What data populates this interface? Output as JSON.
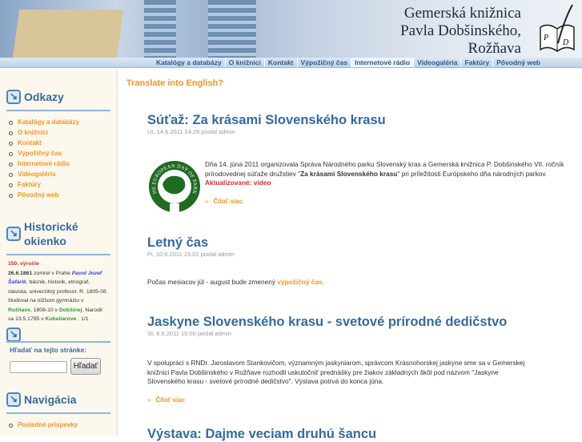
{
  "header": {
    "title_lines": [
      "Gemerská knižnica",
      "Pavla Dobšinského,",
      "Rožňava"
    ],
    "logo_text": "PD"
  },
  "nav": [
    "Katalógy a databázy",
    "O knižnici",
    "Kontakt",
    "Výpožičný čas",
    "Internetové rádio",
    "Videogaléria",
    "Faktúry",
    "Pôvodný web"
  ],
  "sidebar": {
    "odkazy": {
      "title": "Odkazy",
      "items": [
        "Katalógy a databázy",
        "O knižnici",
        "Kontakt",
        "Výpožičný čas",
        "Internetové rádio",
        "Videogaléria",
        "Faktúry",
        "Pôvodný web"
      ]
    },
    "historicke": {
      "title_1": "Historické",
      "title_2": "okienko",
      "anniv": "150. výročie",
      "date": "26.6.1861",
      "t1": " zomrel v Prahe ",
      "name": "Pavol Jozef Šafárik",
      "t2": ", básnik, historik, etnograf, slavista, univerzitný profesor. R. 1805-08 študoval na nižšom gymnáziu v ",
      "place1": "Rožňave",
      "t3": ", 1808-10 v ",
      "place2": "Dobšinej",
      "t4": ". Narodil sa 13.5.1795 v ",
      "place3": "Kobeliarove",
      "t5": ".",
      "pager": "1/1"
    },
    "search": {
      "label": "Hľadať na tejto stránke:",
      "value": "",
      "button": "Hľadať"
    },
    "navigacia": {
      "title": "Navigácia",
      "items": [
        "Posledné príspevky"
      ]
    }
  },
  "main": {
    "translate": "Translate into English?",
    "posts": [
      {
        "title": "Súťaž: Za krásami Slovenského krasu",
        "meta": "Ut, 14.6.2011 14:29 poslal admin",
        "body_1": "Dňa 14. júna 2011 organizovala Správa Národného parku Slovenský kras a Gemerská knižnica P. Dobšinského VII. ročník prírodovednej súťaže družstiev \"",
        "body_bold": "Za krásami Slovenského krasu",
        "body_2": "\" pri príležitosti Európskeho dňa národných parkov.",
        "update": "Aktualizované: video",
        "more": "Čítať viac",
        "image_text": "THE EUROPEAN DAY OF PARKS"
      },
      {
        "title": "Letný čas",
        "meta": "Pi, 10.6.2011 15:02 poslal admin",
        "body_1": "Počas mesiacov júl - august bude zmenený ",
        "body_link": "výpožičný čas",
        "body_2": "."
      },
      {
        "title": "Jaskyne Slovenského krasu - svetové prírodné dedičstvo",
        "meta": "St, 8.6.2011 15:00 poslal admin",
        "body": "V spolupráci s RNDr. Jaroslavom Stankovičom, významným jaskyniarom, správcom Krásnohorskej jaskyne sme sa v Gemerskej knižnici Pavla Dobšinského v Rožňave rozhodli uskutočniť prednášky pre žiakov základných škôl pod názvom \"Jaskyne Slovenského krasu - svetové prírodné dedičstvo\". Výstava potrvá do konca júna.",
        "more": "Čítať viac"
      },
      {
        "title": "Výstava: Dajme veciam druhú šancu"
      }
    ]
  }
}
